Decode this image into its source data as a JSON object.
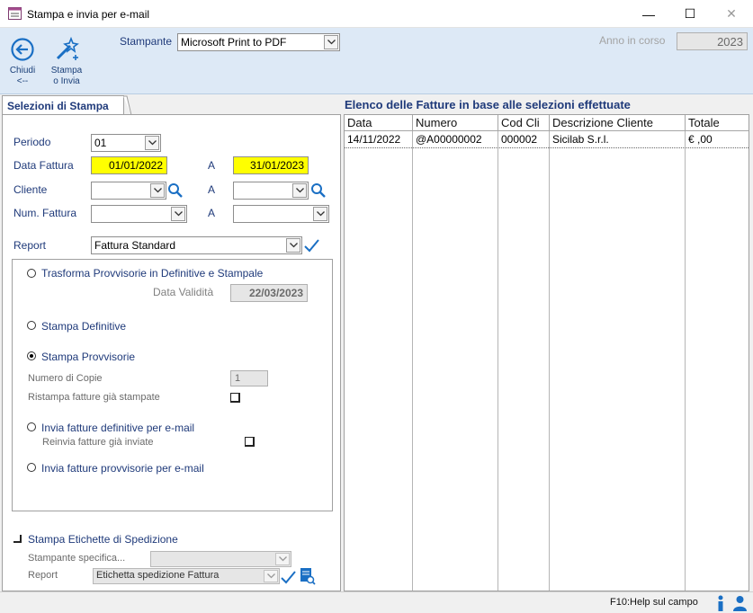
{
  "window": {
    "title": "Stampa e invia per e-mail",
    "controls": {
      "minimize": "—",
      "maximize": "☐",
      "close": "✕"
    }
  },
  "toolbar": {
    "close_label_line1": "Chiudi",
    "close_label_line2": "<--",
    "print_label_line1": "Stampa",
    "print_label_line2": "o Invia",
    "printer_label": "Stampante",
    "printer_value": "Microsoft Print to PDF",
    "year_label": "Anno in corso",
    "year_value": "2023"
  },
  "selections": {
    "tab_label": "Selezioni di Stampa",
    "periodo_label": "Periodo",
    "periodo_value": "01",
    "data_fattura_label": "Data Fattura",
    "data_da": "01/01/2022",
    "a_label": "A",
    "data_a": "31/01/2023",
    "cliente_label": "Cliente",
    "cliente_da": "",
    "cliente_a": "",
    "num_fattura_label": "Num. Fattura",
    "num_da": "",
    "num_a": "",
    "report_label": "Report",
    "report_value": "Fattura Standard"
  },
  "options": {
    "trasforma_label": "Trasforma Provvisorie in Definitive e Stampale",
    "data_validita_label": "Data Validità",
    "data_validita_value": "22/03/2023",
    "stampa_definitive_label": "Stampa Definitive",
    "stampa_provvisorie_label": "Stampa Provvisorie",
    "numero_copie_label": "Numero di Copie",
    "numero_copie_value": "1",
    "ristampa_label": "Ristampa fatture già stampate",
    "invia_definitive_label": "Invia fatture definitive per e-mail",
    "reinvia_label": "Reinvia fatture già inviate",
    "invia_provvisorie_label": "Invia fatture provvisorie per e-mail",
    "selected_option": "stampa_provvisorie"
  },
  "shipping": {
    "label": "Stampa Etichette di Spedizione",
    "printer_label": "Stampante specifica...",
    "printer_value": "",
    "report_label": "Report",
    "report_value": "Etichetta spedizione Fattura"
  },
  "invoices": {
    "title": "Elenco delle Fatture in base alle selezioni effettuate",
    "columns": [
      "Data",
      "Numero",
      "Cod Cli",
      "Descrizione Cliente",
      "Totale"
    ],
    "rows": [
      [
        "14/11/2022",
        "@A00000002",
        "000002",
        "Sicilab S.r.l.",
        "€ ,00"
      ]
    ]
  },
  "status": {
    "help_text": "F10:Help sul campo"
  },
  "colors": {
    "toolbar_bg": "#dde9f6",
    "required_field": "#ffff00",
    "accent_blue": "#1a6fc4"
  }
}
